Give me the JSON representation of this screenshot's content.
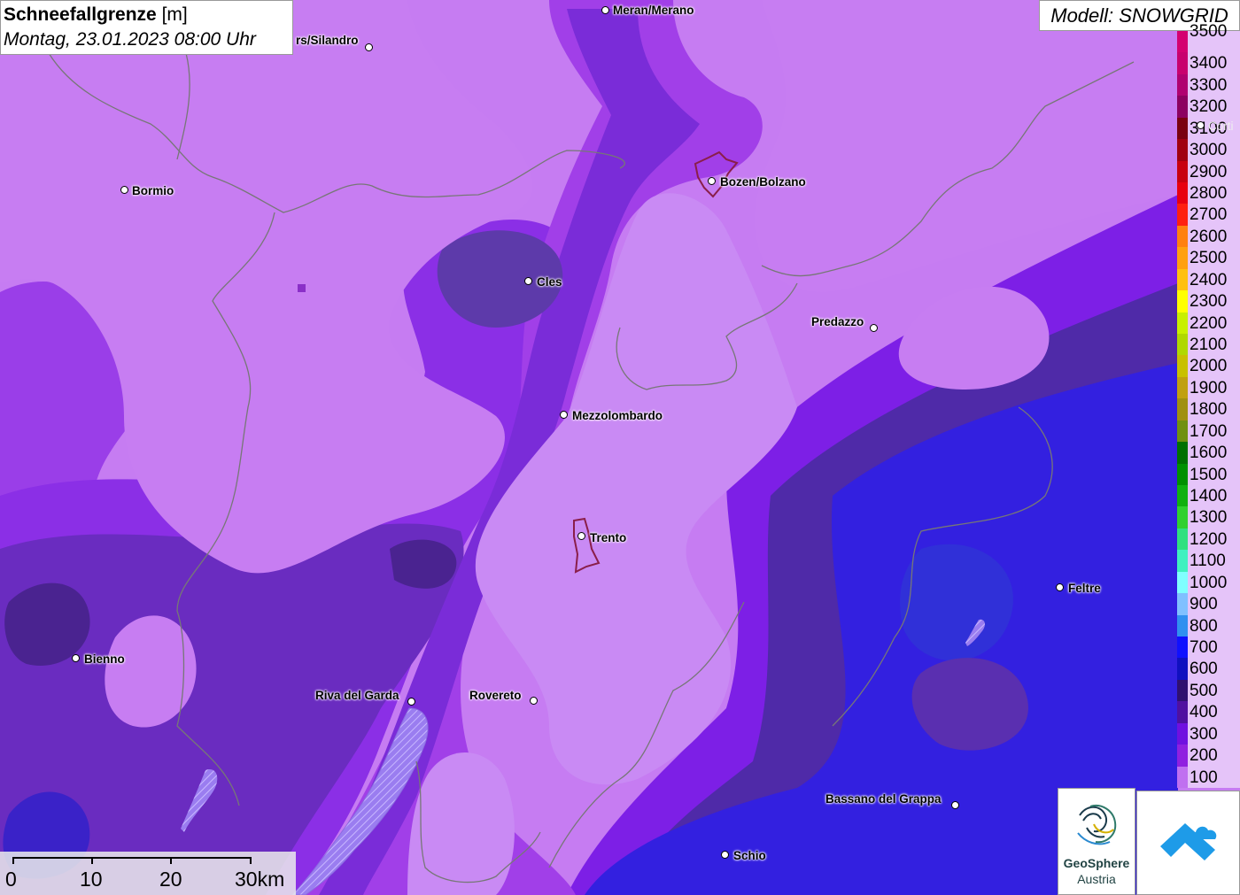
{
  "title": {
    "parameter": "Schneefallgrenze",
    "unit": "[m]",
    "datetime": "Montag, 23.01.2023 08:00 Uhr"
  },
  "model": {
    "label": "Modell: SNOWGRID"
  },
  "legend": {
    "levels": [
      {
        "value": "3500",
        "color": "#d40070"
      },
      {
        "value": "3400",
        "color": "#c8006e"
      },
      {
        "value": "3300",
        "color": "#b00070"
      },
      {
        "value": "3200",
        "color": "#8c0060"
      },
      {
        "value": "3100",
        "color": "#7a0010"
      },
      {
        "value": "3000",
        "color": "#a00010"
      },
      {
        "value": "2900",
        "color": "#c80010"
      },
      {
        "value": "2800",
        "color": "#e80010"
      },
      {
        "value": "2700",
        "color": "#ff2010"
      },
      {
        "value": "2600",
        "color": "#ff8010"
      },
      {
        "value": "2500",
        "color": "#ffa010"
      },
      {
        "value": "2400",
        "color": "#ffc010"
      },
      {
        "value": "2300",
        "color": "#ffff00"
      },
      {
        "value": "2200",
        "color": "#c8f000"
      },
      {
        "value": "2100",
        "color": "#b0d800"
      },
      {
        "value": "2000",
        "color": "#c8c000"
      },
      {
        "value": "1900",
        "color": "#c0a010"
      },
      {
        "value": "1800",
        "color": "#a09010"
      },
      {
        "value": "1700",
        "color": "#709010"
      },
      {
        "value": "1600",
        "color": "#007000"
      },
      {
        "value": "1500",
        "color": "#009000"
      },
      {
        "value": "1400",
        "color": "#10b010"
      },
      {
        "value": "1300",
        "color": "#30d030"
      },
      {
        "value": "1200",
        "color": "#30e080"
      },
      {
        "value": "1100",
        "color": "#40f0c0"
      },
      {
        "value": "1000",
        "color": "#80ffff"
      },
      {
        "value": "900",
        "color": "#80c0ff"
      },
      {
        "value": "800",
        "color": "#3090f0"
      },
      {
        "value": "700",
        "color": "#1010ff"
      },
      {
        "value": "600",
        "color": "#1010c0"
      },
      {
        "value": "500",
        "color": "#301070"
      },
      {
        "value": "400",
        "color": "#5010a0"
      },
      {
        "value": "300",
        "color": "#7010e0"
      },
      {
        "value": "200",
        "color": "#9020e0"
      },
      {
        "value": "100",
        "color": "#c070f0"
      }
    ]
  },
  "cities": [
    {
      "name": "Meran/Merano"
    },
    {
      "name": "rs/Silandro"
    },
    {
      "name": "Bormio"
    },
    {
      "name": "Bozen/Bolzano"
    },
    {
      "name": "Cles"
    },
    {
      "name": "Predazzo"
    },
    {
      "name": "Mezzolombardo"
    },
    {
      "name": "Trento"
    },
    {
      "name": "Feltre"
    },
    {
      "name": "Bienno"
    },
    {
      "name": "Riva del Garda"
    },
    {
      "name": "Rovereto"
    },
    {
      "name": "Bassano del Grappa"
    },
    {
      "name": "Schio"
    },
    {
      "name": "Corti"
    }
  ],
  "scale": {
    "labels": [
      "0",
      "10",
      "20",
      "30km"
    ]
  },
  "logos": {
    "geosphere_line1": "GeoSphere",
    "geosphere_line2": "Austria"
  }
}
